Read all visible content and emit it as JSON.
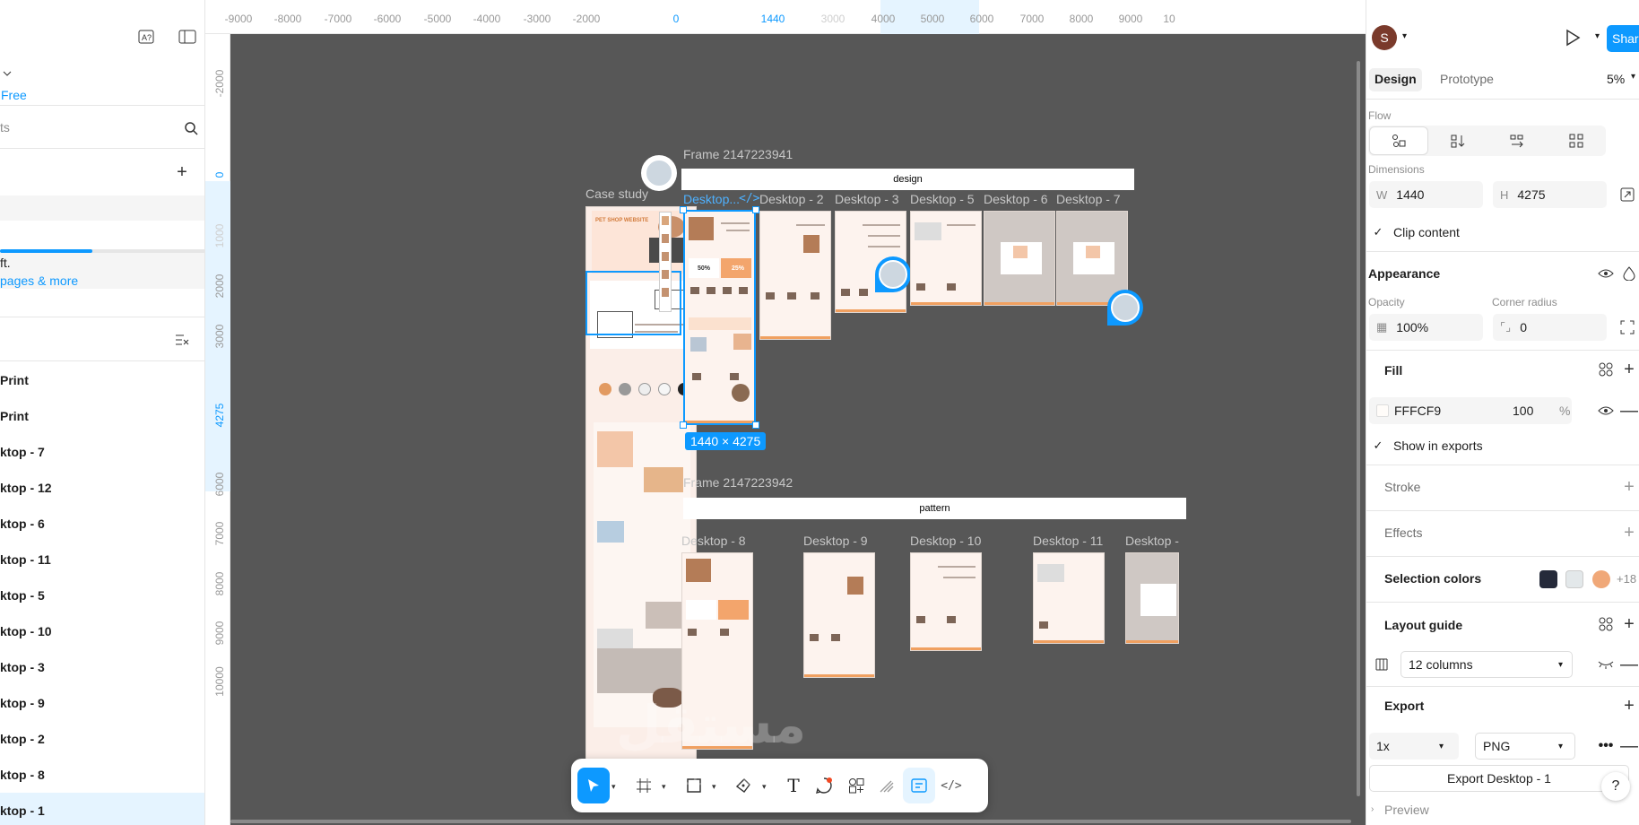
{
  "left_panel": {
    "plan_label": "Free",
    "search_placeholder": "ts",
    "upsell_text": "ft.",
    "upsell_link": "pages & more",
    "progress": 0.45,
    "layers": [
      {
        "label": "Print"
      },
      {
        "label": "Print"
      },
      {
        "label": "ktop - 7"
      },
      {
        "label": "ktop - 12"
      },
      {
        "label": "ktop - 6"
      },
      {
        "label": "ktop - 11"
      },
      {
        "label": "ktop - 5"
      },
      {
        "label": "ktop - 10"
      },
      {
        "label": "ktop - 3"
      },
      {
        "label": "ktop - 9"
      },
      {
        "label": "ktop - 2"
      },
      {
        "label": "ktop - 8"
      },
      {
        "label": "ktop - 1"
      }
    ]
  },
  "rulers": {
    "top": [
      "-9000",
      "-8000",
      "-7000",
      "-6000",
      "-5000",
      "-4000",
      "-3000",
      "-2000",
      "0",
      "1440",
      "3000",
      "4000",
      "5000",
      "6000",
      "7000",
      "8000",
      "9000",
      "10"
    ],
    "left": [
      "-2000",
      "0",
      "1000",
      "2000",
      "3000",
      "4275",
      "6000",
      "7000",
      "8000",
      "9000",
      "10000"
    ]
  },
  "canvas": {
    "case_study_label": "Case study",
    "case_study_title": "PET SHOP WEBSITE",
    "frame1_label": "Frame 2147223941",
    "frame1_bar": "design",
    "frame2_label": "Frame 2147223942",
    "frame2_bar": "pattern",
    "top_row_labels": [
      "Desktop...",
      "Desktop - 2",
      "Desktop - 3",
      "Desktop - 5",
      "Desktop - 6",
      "Desktop - 7"
    ],
    "bottom_row_labels": [
      "Desktop - 8",
      "Desktop - 9",
      "Desktop - 10",
      "Desktop - 11",
      "Desktop -"
    ],
    "selection_dims": "1440 × 4275",
    "promo_50": "50%",
    "promo_25": "25%"
  },
  "toolbar": {
    "tools": [
      "move-tool",
      "frame-tool",
      "shape-tool",
      "pen-tool",
      "text-tool",
      "comment-tool",
      "actions-tool",
      "draw-tool",
      "dev-mode-tool",
      "code-tool"
    ]
  },
  "right_panel": {
    "avatar_initial": "S",
    "share_label": "Share",
    "tabs": {
      "design": "Design",
      "prototype": "Prototype"
    },
    "zoom": "5%",
    "flow_label": "Flow",
    "dimensions_label": "Dimensions",
    "width_prefix": "W",
    "width": "1440",
    "height_prefix": "H",
    "height": "4275",
    "clip_content": "Clip content",
    "appearance": "Appearance",
    "opacity_label": "Opacity",
    "opacity": "100%",
    "corner_radius_label": "Corner radius",
    "corner_radius": "0",
    "fill": "Fill",
    "fill_hex": "FFFCF9",
    "fill_opacity": "100",
    "fill_pct": "%",
    "show_in_exports": "Show in exports",
    "stroke": "Stroke",
    "effects": "Effects",
    "selection_colors": "Selection colors",
    "selection_colors_more": "+18",
    "selection_swatches": [
      "#252a3a",
      "#e3e8ea",
      "#f0a878"
    ],
    "layout_guide": "Layout guide",
    "columns": "12 columns",
    "export": "Export",
    "export_scale": "1x",
    "export_format": "PNG",
    "export_button": "Export Desktop - 1",
    "preview": "Preview",
    "help": "?"
  },
  "watermark": {
    "line1": "مستقل",
    "line2": "mostaql.com"
  }
}
